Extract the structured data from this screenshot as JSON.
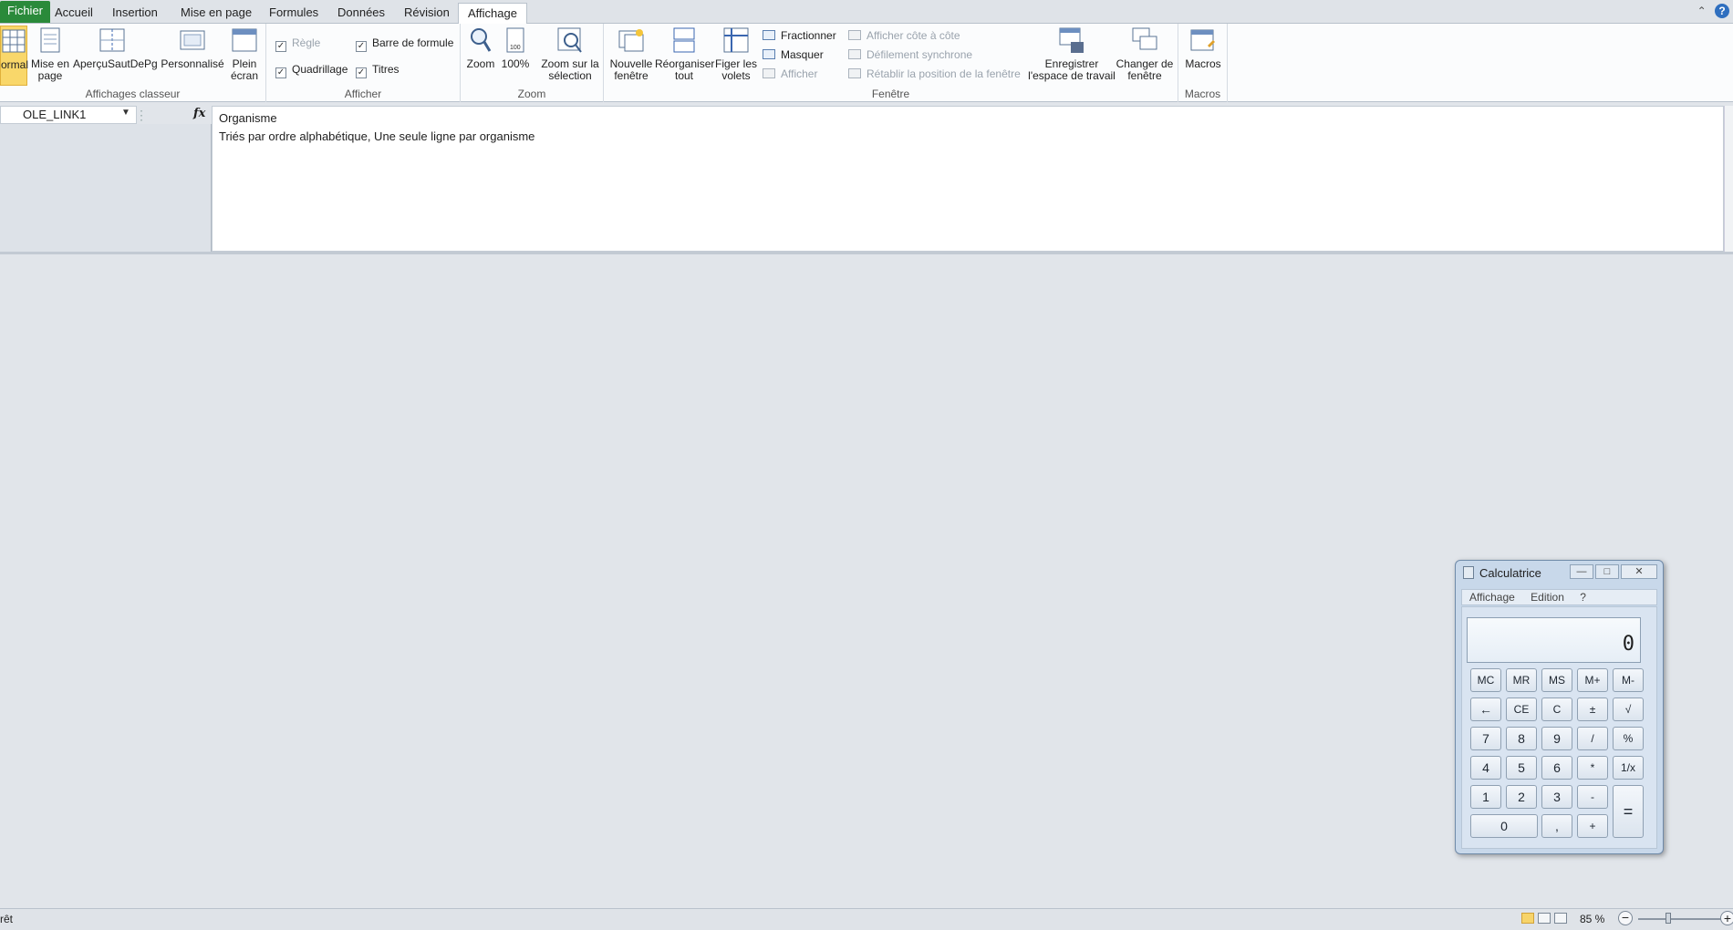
{
  "tabs": {
    "file": "Fichier",
    "accueil": "Accueil",
    "insertion": "Insertion",
    "mise_en_page": "Mise en page",
    "formules": "Formules",
    "donnees": "Données",
    "revision": "Révision",
    "affichage": "Affichage"
  },
  "ribbon": {
    "affichages_classeur": {
      "label": "Affichages classeur",
      "normal": "ormal",
      "mise_en_page": "Mise en page",
      "apercu": "AperçuSautDePg",
      "personnalise": "Personnalisé",
      "plein_ecran": "Plein écran"
    },
    "afficher": {
      "label": "Afficher",
      "regle": "Règle",
      "barre_formule": "Barre de formule",
      "quadrillage": "Quadrillage",
      "titres": "Titres"
    },
    "zoom": {
      "label": "Zoom",
      "zoom": "Zoom",
      "cent": "100%",
      "zoom_selection": "Zoom sur la sélection"
    },
    "fenetre": {
      "label": "Fenêtre",
      "nouvelle": "Nouvelle fenêtre",
      "reorganiser": "Réorganiser tout",
      "figer": "Figer les volets",
      "fractionner": "Fractionner",
      "masquer": "Masquer",
      "afficher": "Afficher",
      "cote_a_cote": "Afficher côte à côte",
      "defilement": "Défilement synchrone",
      "retablir": "Rétablir la position de la fenêtre",
      "enregistrer": "Enregistrer l'espace de travail",
      "changer": "Changer de fenêtre"
    },
    "macros": {
      "label": "Macros",
      "macros": "Macros"
    }
  },
  "formula_bar": {
    "name_box": "OLE_LINK1",
    "fx": "fx",
    "line1": "Organisme",
    "line2": "Triés par ordre alphabétique, Une seule ligne par organisme"
  },
  "status_bar": {
    "status": "rêt",
    "zoom": "85 %"
  },
  "calculator": {
    "title": "Calculatrice",
    "menu": [
      "Affichage",
      "Edition",
      "?"
    ],
    "display": "0",
    "keys": {
      "mc": "MC",
      "mr": "MR",
      "ms": "MS",
      "mplus": "M+",
      "mminus": "M-",
      "back": "←",
      "ce": "CE",
      "c": "C",
      "pm": "±",
      "sqrt": "√",
      "k7": "7",
      "k8": "8",
      "k9": "9",
      "div": "/",
      "pct": "%",
      "k4": "4",
      "k5": "5",
      "k6": "6",
      "mul": "*",
      "inv": "1/x",
      "k1": "1",
      "k2": "2",
      "k3": "3",
      "sub": "-",
      "eq": "=",
      "k0": "0",
      "dec": ",",
      "add": "+"
    }
  },
  "colors": {
    "file_tab": "#2a8a3a",
    "normal_highlight": "#f9d76a"
  }
}
